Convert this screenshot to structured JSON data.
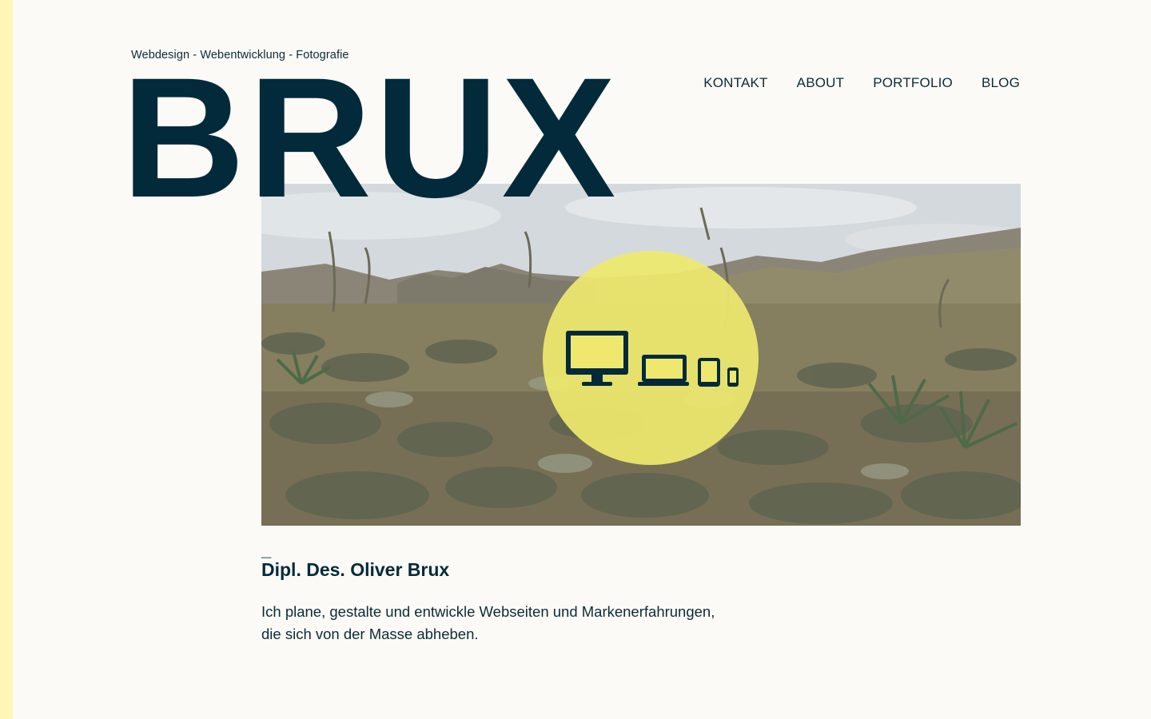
{
  "site": {
    "tagline": "Webdesign - Webentwicklung - Fotografie",
    "logo": "BRUX"
  },
  "nav": {
    "items": [
      {
        "label": "KONTAKT"
      },
      {
        "label": "ABOUT"
      },
      {
        "label": "PORTFOLIO"
      },
      {
        "label": "BLOG"
      }
    ]
  },
  "hero": {
    "icons": [
      "desktop-icon",
      "laptop-icon",
      "tablet-icon",
      "phone-icon"
    ],
    "circle_color": "#eee86e"
  },
  "intro": {
    "dash": "_",
    "name": "Dipl. Des. Oliver Brux",
    "line1": "Ich plane, gestalte und entwickle Webseiten und Markenerfahrungen,",
    "line2": "die sich von der Masse abheben."
  },
  "colors": {
    "primary": "#032a3a",
    "accent": "#fdf6b6",
    "background": "#fbfaf6"
  }
}
